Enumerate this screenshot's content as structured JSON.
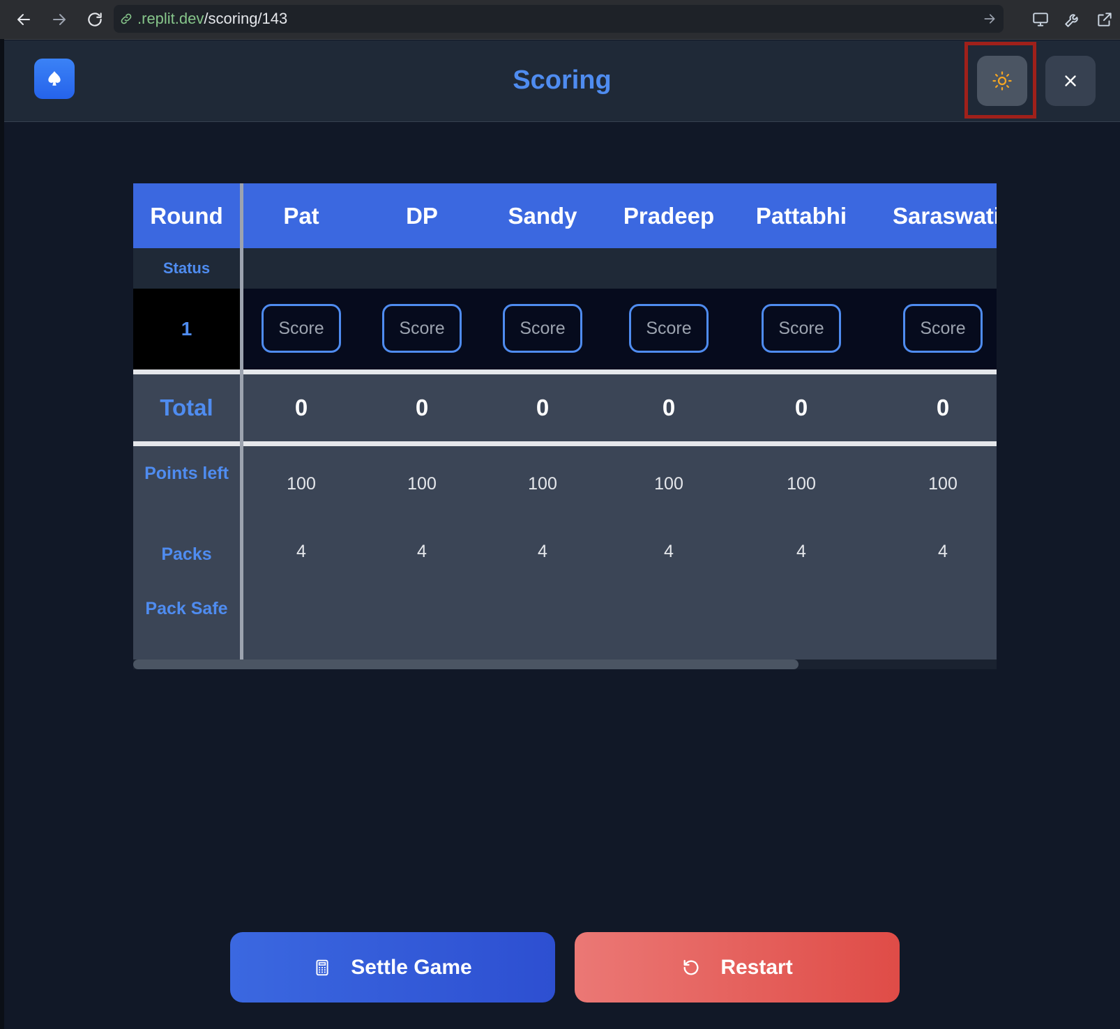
{
  "browser": {
    "url_prefix": ".replit.dev",
    "url_path": "/scoring/143"
  },
  "header": {
    "title": "Scoring"
  },
  "table": {
    "round_header": "Round",
    "players": [
      "Pat",
      "DP",
      "Sandy",
      "Pradeep",
      "Pattabhi",
      "Saraswati"
    ],
    "status_label": "Status",
    "rounds": [
      {
        "number": "1",
        "score_placeholder": "Score"
      }
    ],
    "total_label": "Total",
    "totals": [
      "0",
      "0",
      "0",
      "0",
      "0",
      "0"
    ],
    "points_left_label": "Points left",
    "points_left": [
      "100",
      "100",
      "100",
      "100",
      "100",
      "100"
    ],
    "packs_label": "Packs",
    "packs": [
      "4",
      "4",
      "4",
      "4",
      "4",
      "4"
    ],
    "pack_safe_label": "Pack Safe",
    "pack_safe": [
      "",
      "",
      "",
      "",
      "",
      ""
    ]
  },
  "actions": {
    "settle_label": "Settle Game",
    "restart_label": "Restart"
  },
  "icons": {
    "logo": "spade-icon",
    "theme": "sun-icon",
    "close": "close-icon",
    "settle": "calculator-icon",
    "restart": "rotate-ccw-icon"
  },
  "colors": {
    "accent": "#3b68e0",
    "title": "#4f8cf0",
    "danger": "#df4c47",
    "sun": "#f5a623"
  }
}
